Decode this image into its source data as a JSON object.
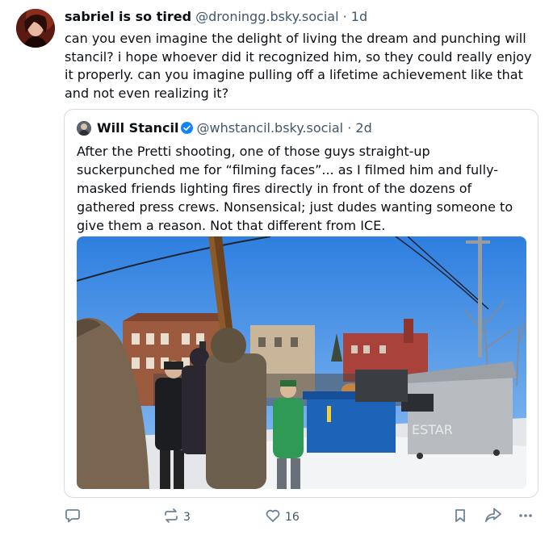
{
  "post": {
    "author_name": "sabriel is so tired",
    "author_handle": "@droningg.bsky.social",
    "separator": "·",
    "time": "1d",
    "text": "can you even imagine the delight of living the dream and punching will stancil? i hope whoever did it recognized him, so they could really enjoy it properly. can you imagine pulling off a lifetime achievement like that and not even realizing it?"
  },
  "quote": {
    "author_name": "Will Stancil",
    "verified": true,
    "author_handle": "@whstancil.bsky.social",
    "separator": "·",
    "time": "2d",
    "text": "After the Pretti shooting, one of those guys straight-up suckerpunched me for “filming faces”... as I filmed him and fully-masked friends lighting fires directly in front of the dozens of gathered press crews. Nonsensical; just dudes wanting someone to give them a reason. Not that different from ICE.",
    "image": {
      "dumpster_graffiti": "ESTAR"
    }
  },
  "actions": {
    "reply_icon": "speech-bubble-icon",
    "repost_icon": "repost-arrows-icon",
    "repost_count": "3",
    "like_icon": "heart-icon",
    "like_count": "16",
    "bookmark_icon": "bookmark-icon",
    "share_icon": "share-arrow-icon",
    "more_icon": "ellipsis-icon"
  },
  "colors": {
    "text_primary": "#0b0f14",
    "text_secondary": "#42576c",
    "border": "#d4dbe2",
    "verified_blue": "#1083fe"
  }
}
